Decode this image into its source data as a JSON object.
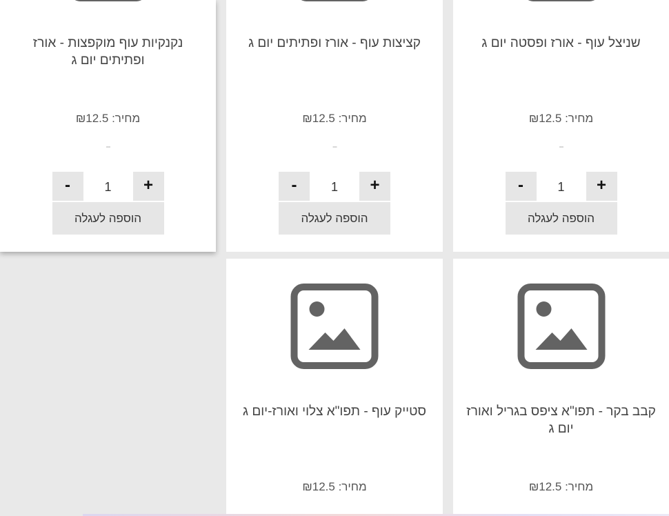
{
  "products": [
    {
      "title": "שניצל עוף - אורז ופסטה יום ג",
      "price_text": "מחיר: ₪12.5",
      "dash": "--",
      "quantity": "1",
      "minus_label": "-",
      "plus_label": "+",
      "add_to_cart_label": "הוספה לעגלה"
    },
    {
      "title": "קציצות עוף - אורז ופתיתים יום ג",
      "price_text": "מחיר: ₪12.5",
      "dash": "--",
      "quantity": "1",
      "minus_label": "-",
      "plus_label": "+",
      "add_to_cart_label": "הוספה לעגלה"
    },
    {
      "title": "נקנקיות עוף מוקפצות - אורז ופתיתים יום ג",
      "price_text": "מחיר: ₪12.5",
      "dash": "--",
      "quantity": "1",
      "minus_label": "-",
      "plus_label": "+",
      "add_to_cart_label": "הוספה לעגלה"
    },
    {
      "title": "קבב בקר - תפו\"א ציפס בגריל ואורז יום ג",
      "price_text": "מחיר: ₪12.5",
      "image_icon": "image-placeholder-icon"
    },
    {
      "title": "סטייק עוף - תפו\"א צלוי ואורז-יום ג",
      "price_text": "מחיר: ₪12.5",
      "image_icon": "image-placeholder-icon"
    }
  ],
  "colors": {
    "page_background": "#e9e9e9",
    "card_background": "#ffffff",
    "button_background": "#e6e6e6",
    "icon_color": "#636363"
  }
}
